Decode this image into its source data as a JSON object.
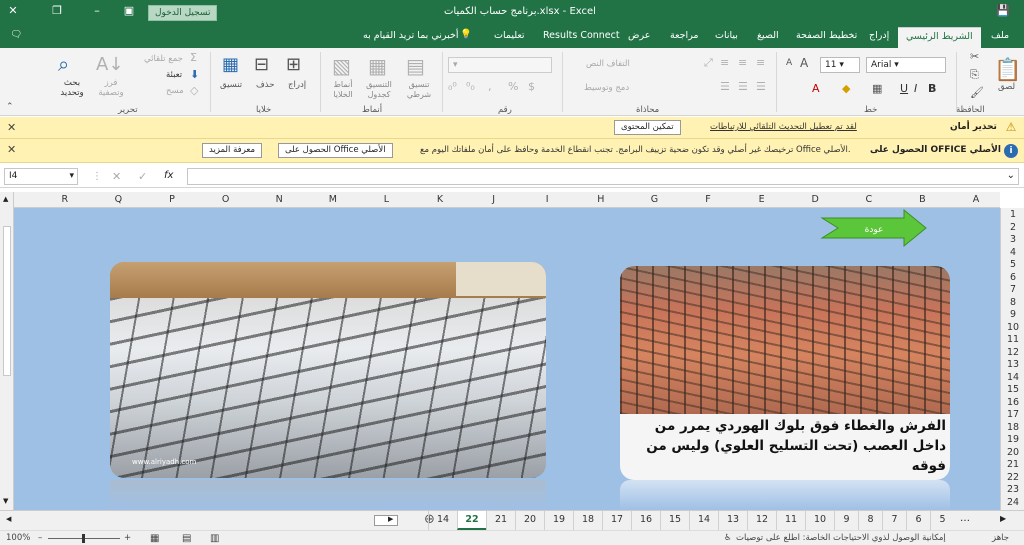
{
  "title_bar": {
    "title": "برنامج حساب الكميات.xlsx - Excel",
    "sign_in": "تسجيل الدخول"
  },
  "tabs": [
    {
      "label": "ملف"
    },
    {
      "label": "الشريط الرئيسي"
    },
    {
      "label": "إدراج"
    },
    {
      "label": "تخطيط الصفحة"
    },
    {
      "label": "الصيغ"
    },
    {
      "label": "بيانات"
    },
    {
      "label": "مراجعة"
    },
    {
      "label": "عرض"
    },
    {
      "label": "Results Connect"
    },
    {
      "label": "تعليمات"
    },
    {
      "label": "أخبرني بما تريد القيام به"
    }
  ],
  "ribbon": {
    "paste": "لصق",
    "clipboard_group": "الحافظة",
    "font_name": "Arial",
    "font_size": "11",
    "font_group": "خط",
    "wrap_text": "التفاف النص",
    "merge_center": "دمج وتوسيط",
    "alignment_group": "محاذاة",
    "number_group": "رقم",
    "conditional_format": "تنسيق شرطي",
    "format_table": "التنسيق كجدول",
    "cell_styles": "أنماط الخلايا",
    "styles_group": "أنماط",
    "insert": "إدراج",
    "delete": "حذف",
    "format": "تنسيق",
    "cells_group": "خلايا",
    "autosum": "جمع تلقائي",
    "fill": "تعبئة",
    "clear": "مسح",
    "sort_filter": "فرز وتصفية",
    "find_select": "بحث وتحديد",
    "editing_group": "تحرير"
  },
  "messages": {
    "security": {
      "title": "تحذير أمان",
      "text": "لقد تم تعطيل التحديث التلقائي للارتباطات",
      "button": "تمكين المحتوى"
    },
    "office": {
      "title": "الحصول على OFFICE الأصلي",
      "text": "ترخيصك غير أصلي وقد تكون ضحية تزييف البرامج. تجنب انقطاع الخدمة وحافظ على أمان ملفاتك اليوم مع Office الأصلي.",
      "button_get": "الحصول على Office الأصلي",
      "button_learn": "معرفة المزيد"
    }
  },
  "formula_bar": {
    "name_box": "I4",
    "fx": "fx",
    "value": ""
  },
  "columns": [
    "A",
    "B",
    "C",
    "D",
    "E",
    "F",
    "G",
    "H",
    "I",
    "J",
    "K",
    "L",
    "M",
    "N",
    "O",
    "P",
    "Q",
    "R"
  ],
  "rows": [
    "1",
    "2",
    "3",
    "4",
    "5",
    "6",
    "7",
    "8",
    "9",
    "10",
    "11",
    "12",
    "13",
    "14",
    "15",
    "16",
    "17",
    "18",
    "19",
    "20",
    "21",
    "22",
    "23",
    "24"
  ],
  "content": {
    "arrow_text": "عودة",
    "caption": "الفرش والغطاء فوق بلوك الهوردي يمرر من داخل العصب (تحت التسليح العلوي) وليس من فوقه",
    "photo_watermark": "www.alriyadh.com"
  },
  "sheet_tabs": [
    "5",
    "6",
    "7",
    "8",
    "9",
    "10",
    "11",
    "12",
    "13",
    "14",
    "15",
    "16",
    "17",
    "18",
    "19",
    "20",
    "21",
    "22",
    "14"
  ],
  "active_sheet": "22",
  "status": {
    "ready": "جاهز",
    "accessibility": "إمكانية الوصول لذوي الاحتياجات الخاصة: اطلع على توصيات",
    "zoom": "100%"
  },
  "colors": {
    "excel_green": "#217346",
    "sheet_background": "#9fc0e5",
    "message_bar": "#fff2b3",
    "arrow_green": "#5cc63a"
  }
}
